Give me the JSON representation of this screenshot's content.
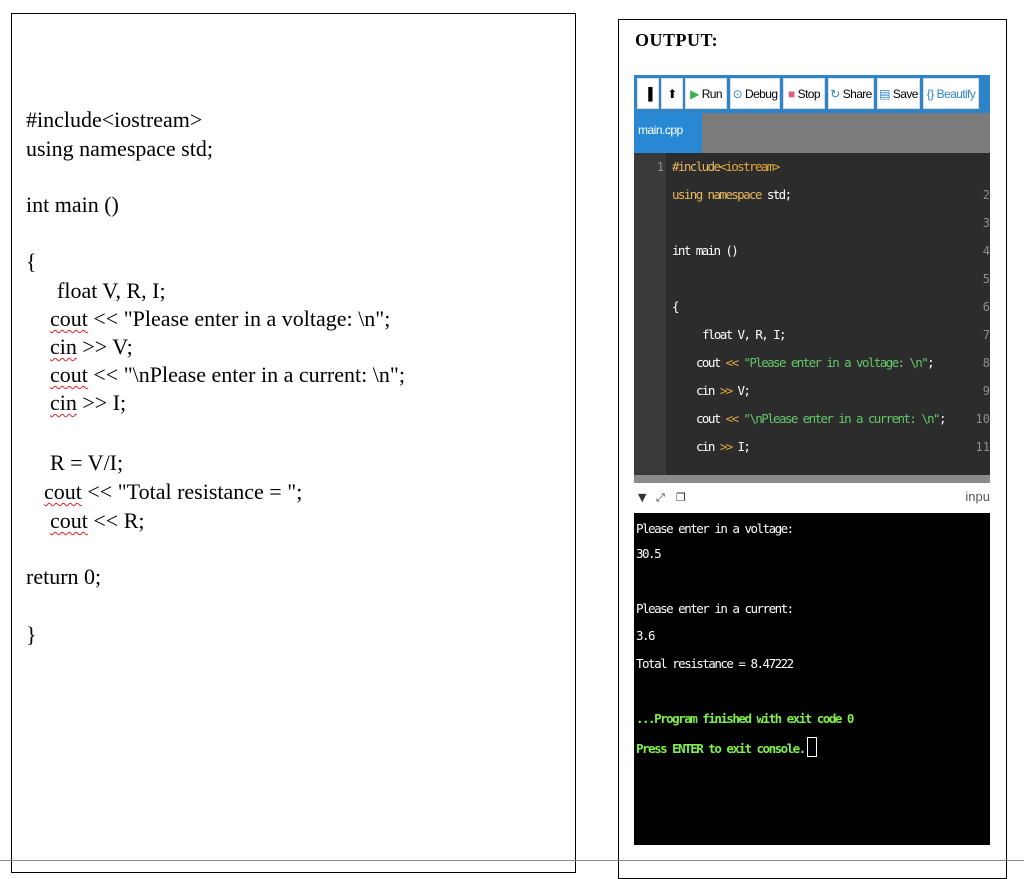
{
  "source_code": {
    "lines": [
      "#include<iostream>",
      "using namespace std;",
      "int main ()",
      "{",
      "float V, R, I;",
      "cout << \"Please enter in a voltage: \\n\";",
      "cin >> V;",
      "cout << \"\\nPlease enter in a current: \\n\";",
      "cin >> I;",
      "R = V/I;",
      "cout << \"Total resistance = \";",
      "cout << R;",
      "return 0;",
      "}"
    ]
  },
  "output": {
    "title": "OUTPUT:",
    "toolbar": {
      "run_label": "Run",
      "debug_label": "Debug",
      "stop_label": "Stop",
      "share_label": "Share",
      "save_label": "Save",
      "beautify_label": "Beautify"
    },
    "tab_name": "main.cpp",
    "editor": {
      "line_numbers": [
        "1",
        "2",
        "3",
        "4",
        "5",
        "6",
        "7",
        "8",
        "9",
        "10",
        "11"
      ],
      "l1_kw": "#include",
      "l1_str": "<iostream>",
      "l2_kw": "using namespace",
      "l2_rest": " std;",
      "l4": "int main ()",
      "l6": "{",
      "l7": "float V, R, I;",
      "l8_a": "cout ",
      "l8_op": "<<",
      "l8_str": " \"Please enter in a voltage: \\n\"",
      "l8_end": ";",
      "l9_a": "cin ",
      "l9_op": ">>",
      "l9_end": " V;",
      "l10_a": "cout ",
      "l10_op": "<<",
      "l10_str": " \"\\nPlease enter in a current: \\n\"",
      "l10_end": ";",
      "l11_a": "cin ",
      "l11_op": ">>",
      "l11_end": " I;"
    },
    "console_input_label": "inpu",
    "console": {
      "prompt_voltage": "Please enter in a voltage:",
      "voltage_value": "30.5",
      "prompt_current": "Please enter in a current:",
      "current_value": "3.6",
      "result": "Total resistance = 8.47222",
      "finished": "...Program finished with exit code 0",
      "exit_prompt": "Press ENTER to exit console."
    }
  },
  "colors": {
    "toolbar_blue": "#2d84c9",
    "run_green": "#3cb04a",
    "stop_pink": "#e0607e",
    "console_green": "#80f04a"
  }
}
